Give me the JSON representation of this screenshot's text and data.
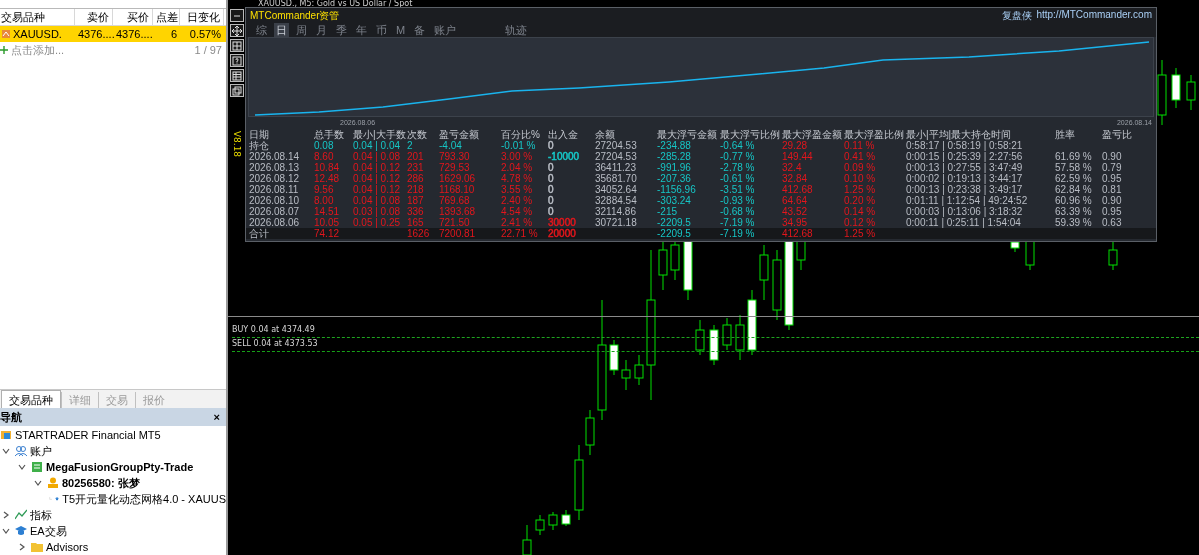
{
  "market_watch": {
    "columns": [
      "交易品种",
      "卖价",
      "买价",
      "点差",
      "日变化"
    ],
    "rows": [
      {
        "cells": [
          "XAUUSD.",
          "4376....",
          "4376....",
          "6",
          "0.57%"
        ],
        "selected": true
      }
    ],
    "add_row": {
      "label": "点击添加...",
      "count": "1 / 97"
    },
    "tabs": [
      {
        "label": "交易品种",
        "selected": true
      },
      {
        "label": "详细",
        "selected": false
      },
      {
        "label": "交易",
        "selected": false
      },
      {
        "label": "报价",
        "selected": false
      }
    ]
  },
  "navigator": {
    "title": "导航",
    "close": "×",
    "tree": [
      {
        "label": "STARTRADER Financial MT5",
        "kind": "root",
        "children": [
          {
            "label": "账户",
            "kind": "accounts",
            "expanded": true,
            "children": [
              {
                "label": "MegaFusionGroupPty-Trade",
                "kind": "server",
                "expanded": true,
                "children": [
                  {
                    "label": "80256580: 张梦",
                    "kind": "account",
                    "expanded": true,
                    "children": [
                      {
                        "label": "T5开元量化动态网格4.0 - XAUUS",
                        "kind": "expert"
                      }
                    ]
                  }
                ]
              }
            ]
          },
          {
            "label": "指标",
            "kind": "indicators",
            "expanded": false
          },
          {
            "label": "EA交易",
            "kind": "experts",
            "expanded": true,
            "children": [
              {
                "label": "Advisors",
                "kind": "folder",
                "expanded": false
              }
            ]
          }
        ]
      }
    ]
  },
  "chart": {
    "title": "XAUUSD., M5: Gold vs US Dollar / Spot",
    "version": "V8.18",
    "orders": [
      {
        "label": "BUY 0.04 at 4374.49",
        "kind": "buy"
      },
      {
        "label": "SELL 0.04 at 4373.53",
        "kind": "sell"
      }
    ]
  },
  "commander": {
    "title": "MTCommander资管",
    "brand": "复盘侠",
    "link": "http://MTCommander.com",
    "tabs": [
      {
        "label": "综",
        "selected": false
      },
      {
        "label": "日",
        "selected": true
      },
      {
        "label": "周",
        "selected": false
      },
      {
        "label": "月",
        "selected": false
      },
      {
        "label": "季",
        "selected": false
      },
      {
        "label": "年",
        "selected": false
      },
      {
        "label": "币",
        "selected": false
      },
      {
        "label": "M",
        "selected": false
      },
      {
        "label": "备",
        "selected": false
      },
      {
        "label": "账户",
        "selected": false
      }
    ],
    "trail_tab": {
      "label": "轨迹",
      "selected": false
    },
    "equity": {
      "start_label": "2026.08.06",
      "end_label": "2026.08.14"
    },
    "columns": [
      "日期",
      "总手数",
      "最小|大手数",
      "次数",
      "盈亏金额",
      "百分比%",
      "出入金",
      "余额",
      "最大浮亏金额",
      "最大浮亏比例",
      "最大浮盈金额",
      "最大浮盈比例",
      "最小|平均|最大持仓时间",
      "胜率",
      "盈亏比"
    ],
    "rows": [
      {
        "kind": "open",
        "cells": [
          "持仓",
          "0.08",
          "0.04 | 0.04",
          "2",
          "-4.04",
          "-0.01 %",
          {
            "text": "0",
            "color": "#b9bdc5"
          },
          "27204.53",
          "-234.88",
          "-0.64 %",
          "29.28",
          "0.11 %",
          "0:58:17 | 0:58:19 | 0:58:21",
          null,
          null
        ]
      },
      {
        "kind": "day",
        "cells": [
          "2026.08.14",
          "8.60",
          "0.04 | 0.08",
          "201",
          "793.30",
          "3.00 %",
          {
            "text": "-10000",
            "color": "#16c6c6"
          },
          "27204.53",
          "-285.28",
          "-0.77 %",
          "149.44",
          "0.41 %",
          "0:00:15 | 0:25:39 | 2:27:56",
          "61.69 %",
          "0.90"
        ]
      },
      {
        "kind": "day",
        "cells": [
          "2026.08.13",
          "10.84",
          "0.04 | 0.12",
          "231",
          "729.53",
          "2.04 %",
          {
            "text": "0",
            "color": "#b9bdc5"
          },
          "36411.23",
          "-991.96",
          "-2.78 %",
          "32.4",
          "0.09 %",
          "0:00:13 | 0:27:55 | 3:47:49",
          "57.58 %",
          "0.79"
        ]
      },
      {
        "kind": "day",
        "cells": [
          "2026.08.12",
          "12.48",
          "0.04 | 0.12",
          "286",
          "1629.06",
          "4.78 %",
          {
            "text": "0",
            "color": "#b9bdc5"
          },
          "35681.70",
          "-207.36",
          "-0.61 %",
          "32.84",
          "0.10 %",
          "0:00:02 | 0:19:13 | 3:44:17",
          "62.59 %",
          "0.95"
        ]
      },
      {
        "kind": "day",
        "cells": [
          "2026.08.11",
          "9.56",
          "0.04 | 0.12",
          "218",
          "1168.10",
          "3.55 %",
          {
            "text": "0",
            "color": "#b9bdc5"
          },
          "34052.64",
          "-1156.96",
          "-3.51 %",
          "412.68",
          "1.25 %",
          "0:00:13 | 0:23:38 | 3:49:17",
          "62.84 %",
          "0.81"
        ]
      },
      {
        "kind": "day",
        "cells": [
          "2026.08.10",
          "8.00",
          "0.04 | 0.08",
          "187",
          "769.68",
          "2.40 %",
          {
            "text": "0",
            "color": "#b9bdc5"
          },
          "32884.54",
          "-303.24",
          "-0.93 %",
          "64.64",
          "0.20 %",
          "0:01:11 | 1:12:54 | 49:24:52",
          "60.96 %",
          "0.90"
        ]
      },
      {
        "kind": "day",
        "cells": [
          "2026.08.07",
          "14.51",
          "0.03 | 0.08",
          "336",
          "1393.68",
          "4.54 %",
          {
            "text": "0",
            "color": "#b9bdc5"
          },
          "32114.86",
          "-215",
          "-0.68 %",
          "43.52",
          "0.14 %",
          "0:00:03 | 0:13:06 | 3:18:32",
          "63.39 %",
          "0.95"
        ]
      },
      {
        "kind": "day",
        "cells": [
          "2026.08.06",
          "10.05",
          "0.05 | 0.25",
          "165",
          "721.50",
          "2.41 %",
          {
            "text": "30000",
            "color": "#e3161c"
          },
          "30721.18",
          "-2209.5",
          "-7.19 %",
          "34.95",
          "0.12 %",
          "0:00:11 | 0:25:11 | 1:54:04",
          "59.39 %",
          "0.63"
        ]
      },
      {
        "kind": "total",
        "cells": [
          "合计",
          "74.12",
          null,
          "1626",
          "7200.81",
          "22.71 %",
          {
            "text": "20000",
            "color": "#e3161c"
          },
          null,
          "-2209.5",
          "-7.19 %",
          "412.68",
          "1.25 %",
          null,
          null,
          null
        ]
      }
    ]
  }
}
